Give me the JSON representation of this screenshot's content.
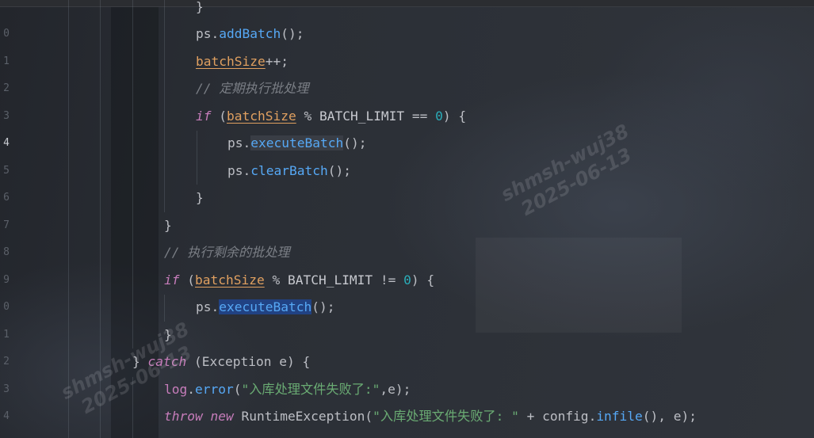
{
  "editor": {
    "top_text": "}",
    "line_numbers": [
      "0",
      "1",
      "2",
      "3",
      "4",
      "5",
      "6",
      "7",
      "8",
      "9",
      "0",
      "1",
      "2",
      "3",
      "4"
    ],
    "active_line_number": "4",
    "lines": {
      "l1": {
        "recv": "ps",
        "dot": ".",
        "method": "addBatch",
        "tail": "();"
      },
      "l2": {
        "var": "batchSize",
        "tail": "++;"
      },
      "l3": {
        "comment": "// 定期执行批处理"
      },
      "l4": {
        "kw": "if",
        "open": " (",
        "var": "batchSize",
        "op1": " % ",
        "const": "BATCH_LIMIT",
        "op2": " == ",
        "num": "0",
        "tail": ") {"
      },
      "l5": {
        "recv": "ps",
        "dot": ".",
        "method": "executeBatch",
        "tail": "();"
      },
      "l6": {
        "recv": "ps",
        "dot": ".",
        "method": "clearBatch",
        "tail": "();"
      },
      "l7": {
        "brace": "}"
      },
      "l8": {
        "brace": "}"
      },
      "l9": {
        "comment": "// 执行剩余的批处理"
      },
      "l10": {
        "kw": "if",
        "open": " (",
        "var": "batchSize",
        "op1": " % ",
        "const": "BATCH_LIMIT",
        "op2": " != ",
        "num": "0",
        "tail": ") {"
      },
      "l11": {
        "recv": "ps",
        "dot": ".",
        "method": "executeBatch",
        "tail": "();"
      },
      "l12": {
        "brace": "}"
      },
      "l13": {
        "brace": "} ",
        "kw": "catch",
        "open": " (",
        "cls": "Exception",
        "param": " e",
        "tail": ") {"
      },
      "l14": {
        "recv": "log",
        "dot": ".",
        "method": "error",
        "open": "(",
        "str": "\"入库处理文件失败了:\"",
        "tail": ",e);"
      },
      "l15": {
        "kw1": "throw",
        "kw2": " new",
        "cls": " RuntimeException",
        "open": "(",
        "str": "\"入库处理文件失败了: \"",
        "op": " + ",
        "recv": "config",
        "dot": ".",
        "method": "infile",
        "tail": "(), e);"
      }
    }
  },
  "watermarks": [
    {
      "line1": "shmsh-wuj38",
      "line2": "2025-06-13"
    },
    {
      "line1": "shmsh-wuj38",
      "line2": "2025-06-13"
    }
  ]
}
